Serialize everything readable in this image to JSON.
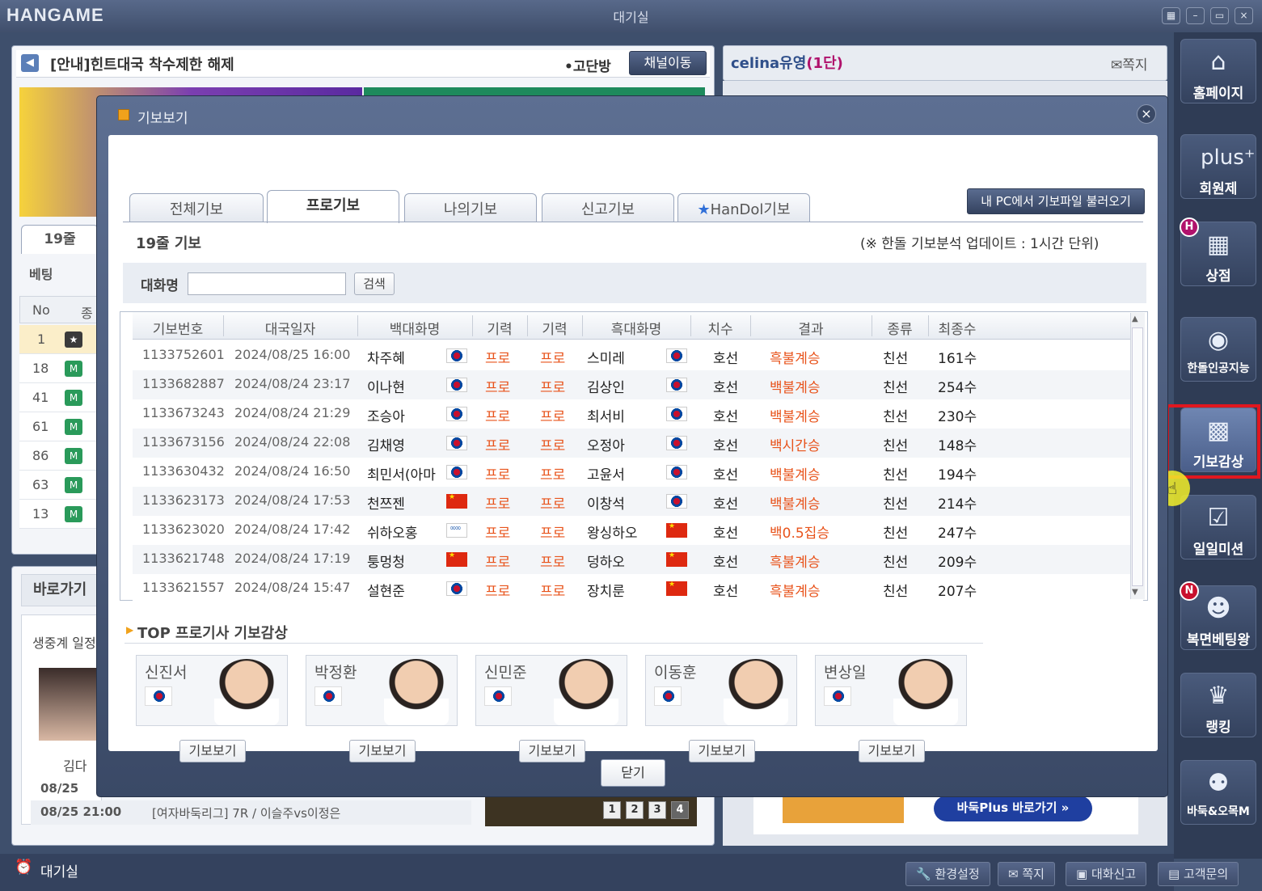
{
  "app": {
    "logo": "HANGAME",
    "title": "대기실"
  },
  "notice": {
    "text": "[안내]힌트대국 착수제한 해제",
    "room": "•고단방",
    "channel_button": "채널이동"
  },
  "user": {
    "name": "celina유영",
    "rank": "(1단)",
    "message": "쪽지"
  },
  "left_tab": "19줄",
  "left_labels": {
    "betting": "베팅",
    "no_col": "No",
    "species_col": "종"
  },
  "left_list": [
    "1",
    "18",
    "41",
    "61",
    "86",
    "63",
    "13"
  ],
  "shortcut": {
    "title": "바로가기",
    "schedule": "생중계 일정",
    "person": "김다",
    "dates": [
      "08/25",
      "08/25 21:00"
    ],
    "event": "[여자바둑리그] 7R / 이슬주vs이정은"
  },
  "pager": [
    "1",
    "2",
    "3",
    "4"
  ],
  "ad": {
    "button": "바둑Plus 바로가기 »"
  },
  "right_sidebar": [
    {
      "label": "홈페이지",
      "icon": "home-icon",
      "glyph": "⌂"
    },
    {
      "label": "회원제",
      "icon": "plus-icon",
      "glyph": "plus⁺"
    },
    {
      "label": "상점",
      "icon": "store-icon",
      "glyph": "▦",
      "badge": "H"
    },
    {
      "label": "한돌인공지능",
      "icon": "robot-icon",
      "glyph": "◉"
    },
    {
      "label": "기보감상",
      "icon": "go-board-icon",
      "glyph": "▩"
    },
    {
      "label": "일일미션",
      "icon": "calendar-icon",
      "glyph": "☑"
    },
    {
      "label": "복면베팅왕",
      "icon": "mask-icon",
      "glyph": "☻",
      "badge": "N"
    },
    {
      "label": "랭킹",
      "icon": "trophy-icon",
      "glyph": "♛"
    },
    {
      "label": "바둑&오목M",
      "icon": "game-icon",
      "glyph": "⚉"
    }
  ],
  "bottom_bar": {
    "status": "대기실",
    "buttons": [
      "환경설정",
      "쪽지",
      "대화신고",
      "고객문의"
    ]
  },
  "modal": {
    "title": "기보보기",
    "tabs": [
      "전체기보",
      "프로기보",
      "나의기보",
      "신고기보",
      "HanDol기보"
    ],
    "active_tab": 1,
    "load_button": "내 PC에서 기보파일 불러오기",
    "section_title": "19줄 기보",
    "update_note": "(※ 한돌 기보분석 업데이트 : 1시간 단위)",
    "search": {
      "label": "대화명",
      "value": "",
      "button": "검색"
    },
    "columns": [
      "기보번호",
      "대국일자",
      "백대화명",
      "기력",
      "기력",
      "흑대화명",
      "치수",
      "결과",
      "종류",
      "최종수"
    ],
    "rows": [
      {
        "id": "1133752601",
        "date": "2024/08/25 16:00",
        "white": "차주혜",
        "wflag": "kr",
        "wrank": "프로",
        "brank": "프로",
        "black": "스미레",
        "bflag": "kr",
        "handicap": "호선",
        "result": "흑불계승",
        "type": "친선",
        "moves": "161수"
      },
      {
        "id": "1133682887",
        "date": "2024/08/24 23:17",
        "white": "이나현",
        "wflag": "kr",
        "wrank": "프로",
        "brank": "프로",
        "black": "김상인",
        "bflag": "kr",
        "handicap": "호선",
        "result": "백불계승",
        "type": "친선",
        "moves": "254수"
      },
      {
        "id": "1133673243",
        "date": "2024/08/24 21:29",
        "white": "조승아",
        "wflag": "kr",
        "wrank": "프로",
        "brank": "프로",
        "black": "최서비",
        "bflag": "kr",
        "handicap": "호선",
        "result": "백불계승",
        "type": "친선",
        "moves": "230수"
      },
      {
        "id": "1133673156",
        "date": "2024/08/24 22:08",
        "white": "김채영",
        "wflag": "kr",
        "wrank": "프로",
        "brank": "프로",
        "black": "오정아",
        "bflag": "kr",
        "handicap": "호선",
        "result": "백시간승",
        "type": "친선",
        "moves": "148수"
      },
      {
        "id": "1133630432",
        "date": "2024/08/24 16:50",
        "white": "최민서(아마",
        "wflag": "kr",
        "wrank": "프로",
        "brank": "프로",
        "black": "고윤서",
        "bflag": "kr",
        "handicap": "호선",
        "result": "백불계승",
        "type": "친선",
        "moves": "194수"
      },
      {
        "id": "1133623173",
        "date": "2024/08/24 17:53",
        "white": "천쯔젠",
        "wflag": "cn",
        "wrank": "프로",
        "brank": "프로",
        "black": "이창석",
        "bflag": "kr",
        "handicap": "호선",
        "result": "백불계승",
        "type": "친선",
        "moves": "214수"
      },
      {
        "id": "1133623020",
        "date": "2024/08/24 17:42",
        "white": "쉬하오홍",
        "wflag": "ol",
        "wrank": "프로",
        "brank": "프로",
        "black": "왕싱하오",
        "bflag": "cn",
        "handicap": "호선",
        "result": "백0.5집승",
        "type": "친선",
        "moves": "247수"
      },
      {
        "id": "1133621748",
        "date": "2024/08/24 17:19",
        "white": "퉁멍청",
        "wflag": "cn",
        "wrank": "프로",
        "brank": "프로",
        "black": "덩하오",
        "bflag": "cn",
        "handicap": "호선",
        "result": "흑불계승",
        "type": "친선",
        "moves": "209수"
      },
      {
        "id": "1133621557",
        "date": "2024/08/24 15:47",
        "white": "설현준",
        "wflag": "kr",
        "wrank": "프로",
        "brank": "프로",
        "black": "장치룬",
        "bflag": "cn",
        "handicap": "호선",
        "result": "흑불계승",
        "type": "친선",
        "moves": "207수"
      }
    ],
    "top_title": "TOP 프로기사 기보감상",
    "top_players": [
      "신진서",
      "박정환",
      "신민준",
      "이동훈",
      "변상일"
    ],
    "view_button": "기보보기",
    "close_button": "닫기",
    "close_icon": "×"
  }
}
